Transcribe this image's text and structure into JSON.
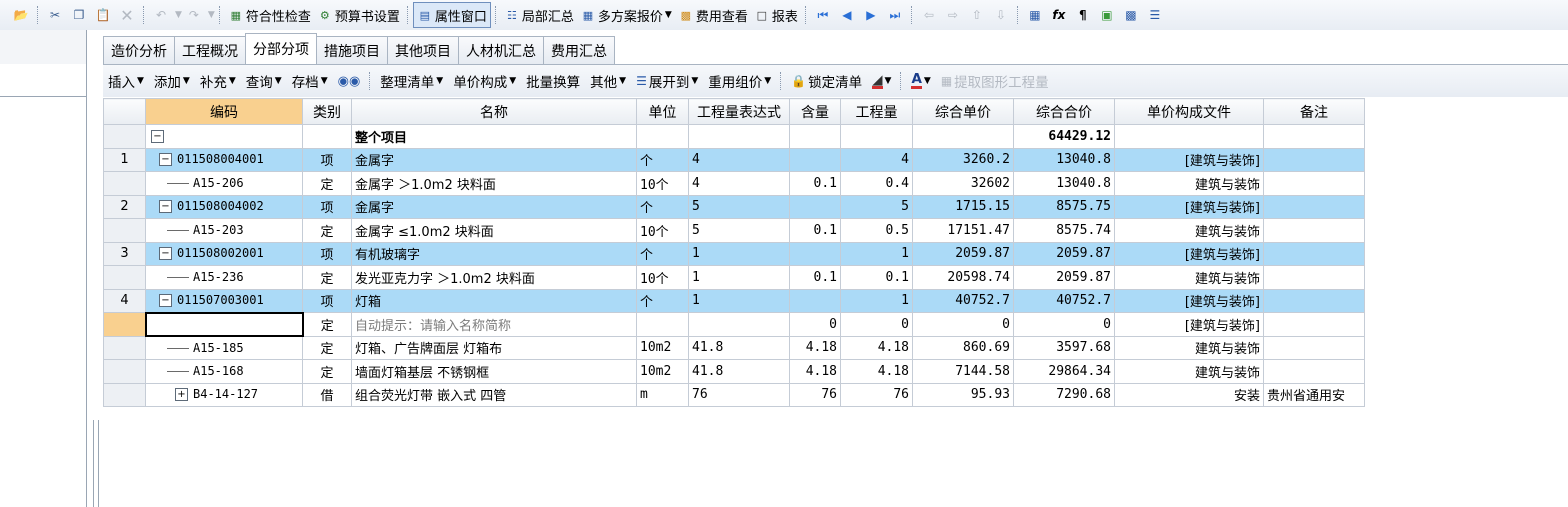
{
  "toolbar": {
    "items": [
      {
        "icon": "open-folder-icon",
        "label": ""
      },
      {
        "icon": "cut-icon",
        "label": ""
      },
      {
        "icon": "copy-icon",
        "label": ""
      },
      {
        "icon": "paste-icon",
        "label": ""
      },
      {
        "icon": "delete-icon",
        "label": ""
      },
      {
        "icon": "undo-icon",
        "label": ""
      },
      {
        "icon": "redo-icon",
        "label": ""
      }
    ],
    "compliance_check": "符合性检查",
    "budget_settings": "预算书设置",
    "property_window": "属性窗口",
    "partial_summary": "局部汇总",
    "multi_plan_quote": "多方案报价",
    "fee_view": "费用查看",
    "report": "报表"
  },
  "tabs": [
    "造价分析",
    "工程概况",
    "分部分项",
    "措施项目",
    "其他项目",
    "人材机汇总",
    "费用汇总"
  ],
  "active_tab": "分部分项",
  "toolbar2": {
    "insert": "插入",
    "add": "添加",
    "supplement": "补充",
    "query": "查询",
    "archive": "存档",
    "organize": "整理清单",
    "unit_price_comp": "单价构成",
    "batch_convert": "批量换算",
    "other": "其他",
    "expand_to": "展开到",
    "reuse_price": "重用组价",
    "lock_list": "锁定清单",
    "extract_quantity": "提取图形工程量"
  },
  "columns": [
    "编码",
    "类别",
    "名称",
    "单位",
    "工程量表达式",
    "含量",
    "工程量",
    "综合单价",
    "综合合价",
    "单价构成文件",
    "备注"
  ],
  "rows": [
    {
      "n": "",
      "code": "",
      "type": "",
      "name": "整个项目",
      "unit": "",
      "expr": "",
      "content": "",
      "qty": "",
      "price": "",
      "total": "64429.12",
      "file": "",
      "note": "",
      "kind": "root"
    },
    {
      "n": "1",
      "code": "011508004001",
      "type": "项",
      "name": "金属字",
      "unit": "个",
      "expr": "4",
      "content": "",
      "qty": "4",
      "price": "3260.2",
      "total": "13040.8",
      "file": "[建筑与装饰]",
      "note": "",
      "kind": "item"
    },
    {
      "n": "",
      "code": "A15-206",
      "type": "定",
      "name": "金属字 ＞1.0m2 块料面",
      "unit": "10个",
      "expr": "4",
      "content": "0.1",
      "qty": "0.4",
      "price": "32602",
      "total": "13040.8",
      "file": "建筑与装饰",
      "note": "",
      "kind": "quota"
    },
    {
      "n": "2",
      "code": "011508004002",
      "type": "项",
      "name": "金属字",
      "unit": "个",
      "expr": "5",
      "content": "",
      "qty": "5",
      "price": "1715.15",
      "total": "8575.75",
      "file": "[建筑与装饰]",
      "note": "",
      "kind": "item"
    },
    {
      "n": "",
      "code": "A15-203",
      "type": "定",
      "name": "金属字 ≤1.0m2 块料面",
      "unit": "10个",
      "expr": "5",
      "content": "0.1",
      "qty": "0.5",
      "price": "17151.47",
      "total": "8575.74",
      "file": "建筑与装饰",
      "note": "",
      "kind": "quota"
    },
    {
      "n": "3",
      "code": "011508002001",
      "type": "项",
      "name": "有机玻璃字",
      "unit": "个",
      "expr": "1",
      "content": "",
      "qty": "1",
      "price": "2059.87",
      "total": "2059.87",
      "file": "[建筑与装饰]",
      "note": "",
      "kind": "item"
    },
    {
      "n": "",
      "code": "A15-236",
      "type": "定",
      "name": "发光亚克力字 ＞1.0m2 块料面",
      "unit": "10个",
      "expr": "1",
      "content": "0.1",
      "qty": "0.1",
      "price": "20598.74",
      "total": "2059.87",
      "file": "建筑与装饰",
      "note": "",
      "kind": "quota"
    },
    {
      "n": "4",
      "code": "011507003001",
      "type": "项",
      "name": "灯箱",
      "unit": "个",
      "expr": "1",
      "content": "",
      "qty": "1",
      "price": "40752.7",
      "total": "40752.7",
      "file": "[建筑与装饰]",
      "note": "",
      "kind": "item"
    },
    {
      "n": "",
      "code": "",
      "type": "定",
      "name": "自动提示：请输入名称简称",
      "unit": "",
      "expr": "",
      "content": "0",
      "qty": "0",
      "price": "0",
      "total": "0",
      "file": "[建筑与装饰]",
      "note": "",
      "kind": "edit"
    },
    {
      "n": "",
      "code": "A15-185",
      "type": "定",
      "name": "灯箱、广告牌面层 灯箱布",
      "unit": "10m2",
      "expr": "41.8",
      "content": "4.18",
      "qty": "4.18",
      "price": "860.69",
      "total": "3597.68",
      "file": "建筑与装饰",
      "note": "",
      "kind": "quota"
    },
    {
      "n": "",
      "code": "A15-168",
      "type": "定",
      "name": "墙面灯箱基层 不锈钢框",
      "unit": "10m2",
      "expr": "41.8",
      "content": "4.18",
      "qty": "4.18",
      "price": "7144.58",
      "total": "29864.34",
      "file": "建筑与装饰",
      "note": "",
      "kind": "quota"
    },
    {
      "n": "",
      "code": "B4-14-127",
      "type": "借",
      "name": "组合荧光灯带 嵌入式 四管",
      "unit": "m",
      "expr": "76",
      "content": "76",
      "qty": "76",
      "price": "95.93",
      "total": "7290.68",
      "file": "安装",
      "note": "贵州省通用安",
      "kind": "borrow"
    }
  ]
}
